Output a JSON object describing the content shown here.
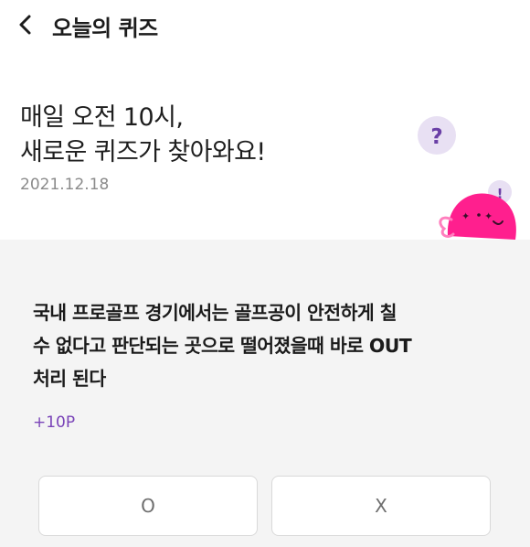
{
  "header": {
    "title": "오늘의 퀴즈"
  },
  "hero": {
    "title_line1": "매일 오전 10시,",
    "title_line2": "새로운 퀴즈가 찾아와요!",
    "date": "2021.12.18",
    "mascot_question_mark": "?",
    "mascot_exclamation": "!"
  },
  "quiz": {
    "question_line1": "국내 프로골프 경기에서는 골프공이 안전하게 칠",
    "question_line2": "수 없다고 판단되는 곳으로 떨어졌을때 바로 OUT",
    "question_line3": "처리 된다",
    "points": "+10P",
    "answer_o": "O",
    "answer_x": "X"
  },
  "colors": {
    "accent_purple": "#7a44b8",
    "mascot_pink": "#ff1f8e",
    "card_background": "#f4f4f4"
  },
  "icons": {
    "back": "chevron-left-icon",
    "mascot": "pink-mascot-illustration"
  }
}
